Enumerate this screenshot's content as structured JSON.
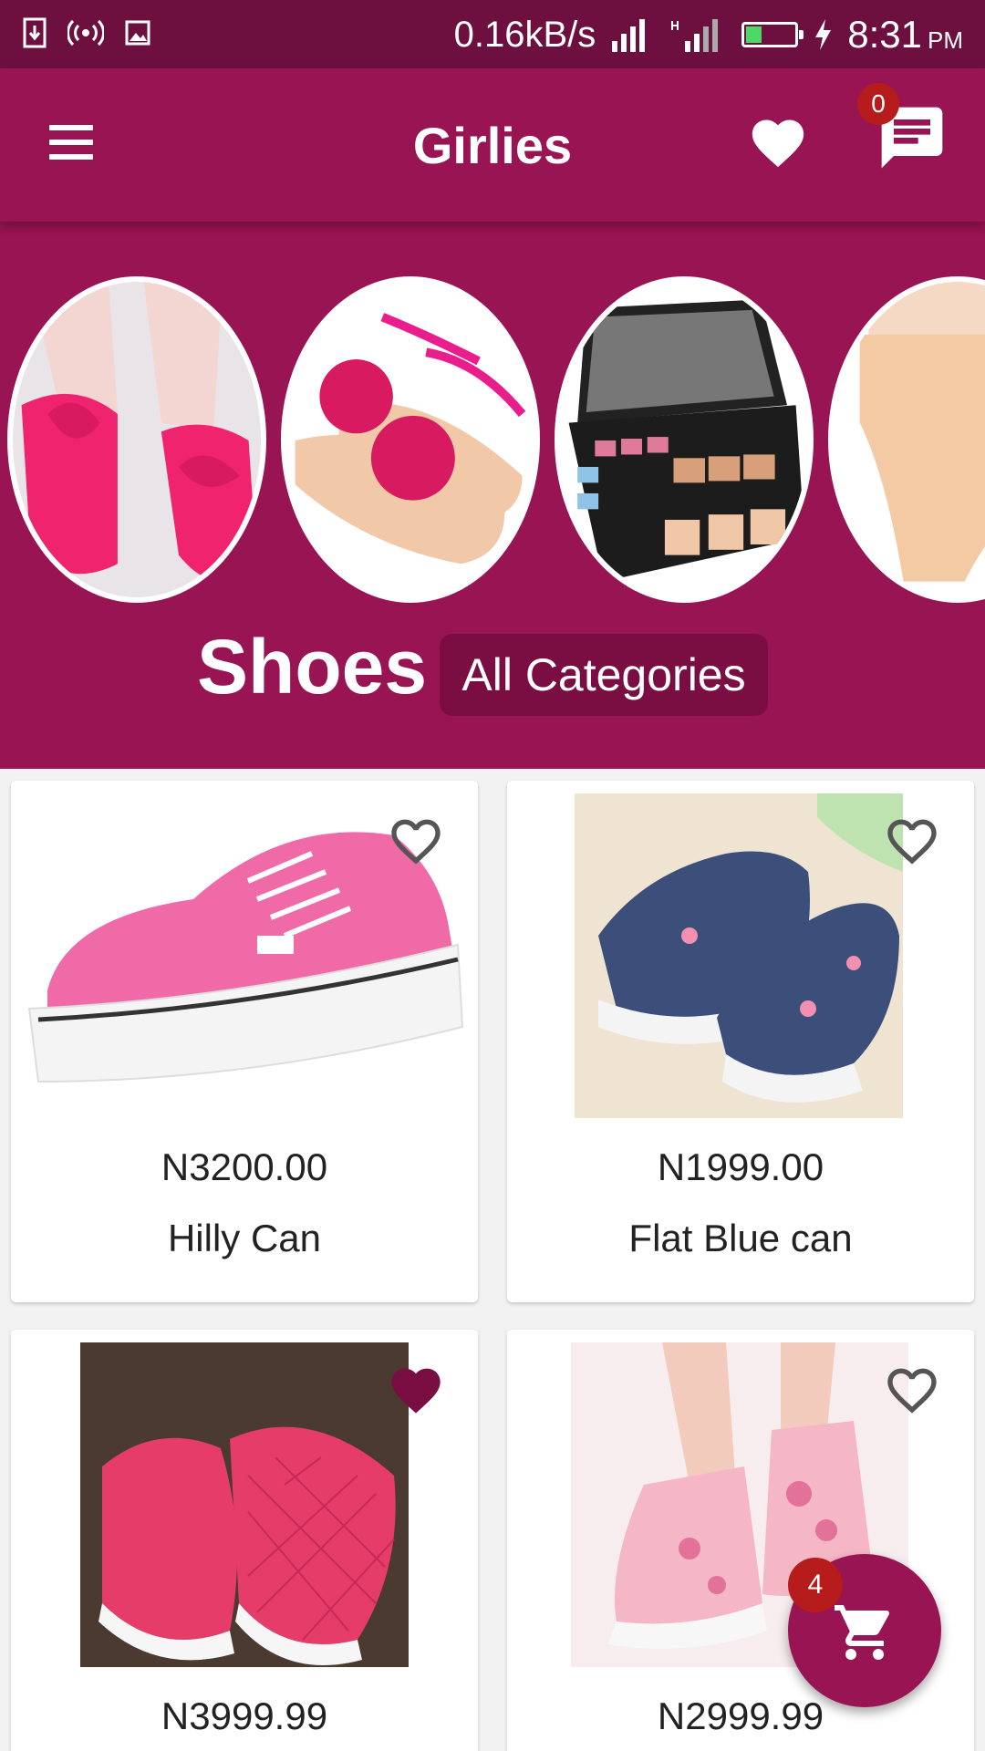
{
  "status_bar": {
    "net_speed": "0.16kB/s",
    "time": "8:31",
    "ampm": "PM",
    "battery_level": 0.3,
    "icons": [
      "usb-icon",
      "hotspot-icon",
      "image-icon",
      "signal-icon",
      "battery-icon",
      "charging-icon"
    ]
  },
  "app_bar": {
    "title": "Girlies",
    "message_badge": "0",
    "icons": [
      "menu-icon",
      "heart-icon",
      "chat-icon"
    ]
  },
  "categories": {
    "current": "Shoes",
    "all_label": "All Categories",
    "bubbles": [
      "shoes",
      "sandals",
      "makeup",
      "underwear"
    ]
  },
  "products": [
    {
      "price": "N3200.00",
      "name": "Hilly Can",
      "favorited": false
    },
    {
      "price": "N1999.00",
      "name": "Flat Blue can",
      "favorited": false
    },
    {
      "price": "N3999.99",
      "name": "",
      "favorited": true
    },
    {
      "price": "N2999.99",
      "name": "",
      "favorited": false
    }
  ],
  "cart": {
    "count": "4"
  },
  "colors": {
    "primary": "#991452",
    "primary_dark": "#6d0f3f",
    "badge": "#b71c1c",
    "bg": "#f2f2f2"
  }
}
